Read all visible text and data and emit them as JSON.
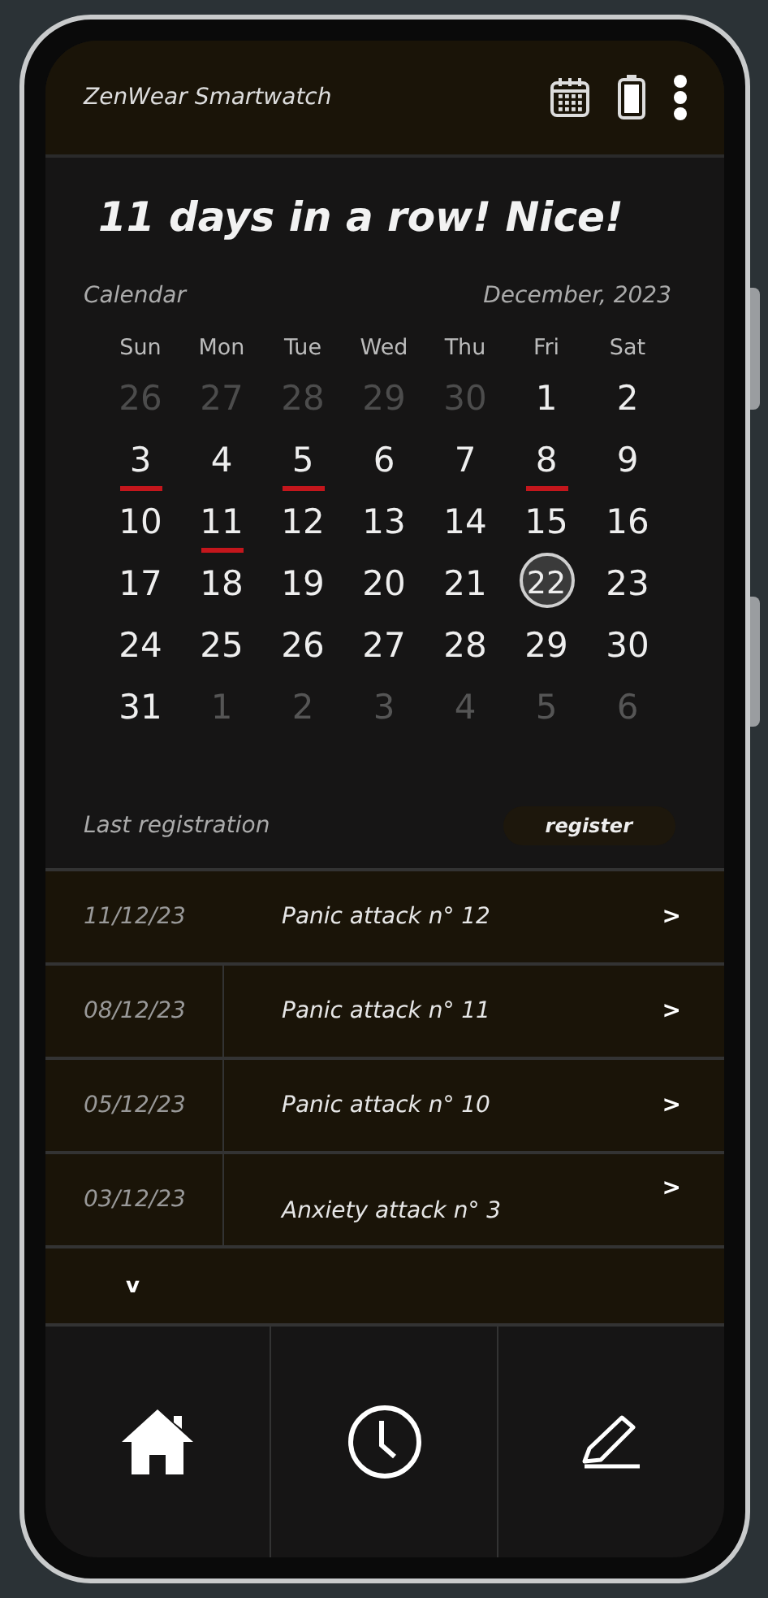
{
  "header": {
    "title": "ZenWear Smartwatch"
  },
  "headline": "11 days in a row! Nice!",
  "calendar": {
    "label": "Calendar",
    "month": "December, 2023",
    "weekdays": [
      "Sun",
      "Mon",
      "Tue",
      "Wed",
      "Thu",
      "Fri",
      "Sat"
    ],
    "weeks": [
      [
        {
          "label": "26",
          "outside": true,
          "marked": false,
          "selected": false
        },
        {
          "label": "27",
          "outside": true,
          "marked": false,
          "selected": false
        },
        {
          "label": "28",
          "outside": true,
          "marked": false,
          "selected": false
        },
        {
          "label": "29",
          "outside": true,
          "marked": false,
          "selected": false
        },
        {
          "label": "30",
          "outside": true,
          "marked": false,
          "selected": false
        },
        {
          "label": "1",
          "outside": false,
          "marked": false,
          "selected": false
        },
        {
          "label": "2",
          "outside": false,
          "marked": false,
          "selected": false
        }
      ],
      [
        {
          "label": "3",
          "outside": false,
          "marked": true,
          "selected": false
        },
        {
          "label": "4",
          "outside": false,
          "marked": false,
          "selected": false
        },
        {
          "label": "5",
          "outside": false,
          "marked": true,
          "selected": false
        },
        {
          "label": "6",
          "outside": false,
          "marked": false,
          "selected": false
        },
        {
          "label": "7",
          "outside": false,
          "marked": false,
          "selected": false
        },
        {
          "label": "8",
          "outside": false,
          "marked": true,
          "selected": false
        },
        {
          "label": "9",
          "outside": false,
          "marked": false,
          "selected": false
        }
      ],
      [
        {
          "label": "10",
          "outside": false,
          "marked": false,
          "selected": false
        },
        {
          "label": "11",
          "outside": false,
          "marked": true,
          "selected": false
        },
        {
          "label": "12",
          "outside": false,
          "marked": false,
          "selected": false
        },
        {
          "label": "13",
          "outside": false,
          "marked": false,
          "selected": false
        },
        {
          "label": "14",
          "outside": false,
          "marked": false,
          "selected": false
        },
        {
          "label": "15",
          "outside": false,
          "marked": false,
          "selected": false
        },
        {
          "label": "16",
          "outside": false,
          "marked": false,
          "selected": false
        }
      ],
      [
        {
          "label": "17",
          "outside": false,
          "marked": false,
          "selected": false
        },
        {
          "label": "18",
          "outside": false,
          "marked": false,
          "selected": false
        },
        {
          "label": "19",
          "outside": false,
          "marked": false,
          "selected": false
        },
        {
          "label": "20",
          "outside": false,
          "marked": false,
          "selected": false
        },
        {
          "label": "21",
          "outside": false,
          "marked": false,
          "selected": false
        },
        {
          "label": "22",
          "outside": false,
          "marked": false,
          "selected": true
        },
        {
          "label": "23",
          "outside": false,
          "marked": false,
          "selected": false
        }
      ],
      [
        {
          "label": "24",
          "outside": false,
          "marked": false,
          "selected": false
        },
        {
          "label": "25",
          "outside": false,
          "marked": false,
          "selected": false
        },
        {
          "label": "26",
          "outside": false,
          "marked": false,
          "selected": false
        },
        {
          "label": "27",
          "outside": false,
          "marked": false,
          "selected": false
        },
        {
          "label": "28",
          "outside": false,
          "marked": false,
          "selected": false
        },
        {
          "label": "29",
          "outside": false,
          "marked": false,
          "selected": false
        },
        {
          "label": "30",
          "outside": false,
          "marked": false,
          "selected": false
        }
      ],
      [
        {
          "label": "31",
          "outside": false,
          "marked": false,
          "selected": false
        },
        {
          "label": "1",
          "outside": true,
          "marked": false,
          "selected": false
        },
        {
          "label": "2",
          "outside": true,
          "marked": false,
          "selected": false
        },
        {
          "label": "3",
          "outside": true,
          "marked": false,
          "selected": false
        },
        {
          "label": "4",
          "outside": true,
          "marked": false,
          "selected": false
        },
        {
          "label": "5",
          "outside": true,
          "marked": false,
          "selected": false
        },
        {
          "label": "6",
          "outside": true,
          "marked": false,
          "selected": false
        }
      ]
    ]
  },
  "registrations": {
    "label": "Last registration",
    "button": "register",
    "rows": [
      {
        "date": "11/12/23",
        "title": "Panic attack n° 12",
        "chevron": ">"
      },
      {
        "date": "08/12/23",
        "title": "Panic attack n° 11",
        "chevron": ">"
      },
      {
        "date": "05/12/23",
        "title": "Panic attack n° 10",
        "chevron": ">"
      },
      {
        "date": "03/12/23",
        "title": "Anxiety attack n° 3",
        "chevron": ">"
      }
    ],
    "more": "v"
  },
  "nav": [
    {
      "kind": "home"
    },
    {
      "kind": "history"
    },
    {
      "kind": "edit"
    }
  ]
}
